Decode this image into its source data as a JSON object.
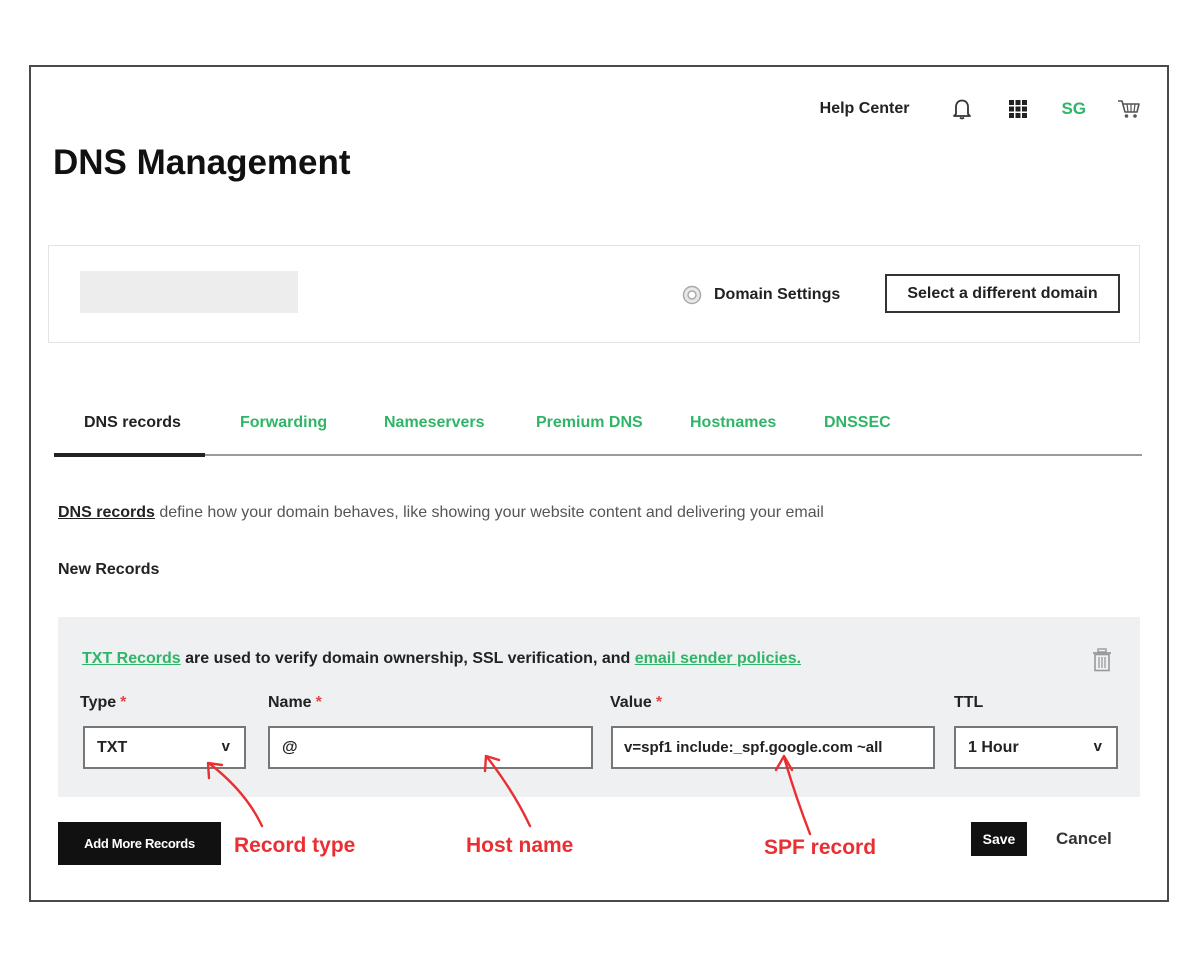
{
  "header": {
    "help_center": "Help Center",
    "user_initials": "SG",
    "icons": [
      "bell-icon",
      "apps-grid-icon",
      "cart-icon"
    ]
  },
  "page_title": "DNS Management",
  "domain_card": {
    "domain_settings": "Domain Settings",
    "select_domain_button": "Select a different domain"
  },
  "tabs": [
    {
      "label": "DNS records",
      "active": true
    },
    {
      "label": "Forwarding",
      "active": false
    },
    {
      "label": "Nameservers",
      "active": false
    },
    {
      "label": "Premium DNS",
      "active": false
    },
    {
      "label": "Hostnames",
      "active": false
    },
    {
      "label": "DNSSEC",
      "active": false
    }
  ],
  "description": {
    "link": "DNS records",
    "text": " define how your domain behaves, like showing your website content and delivering your email"
  },
  "new_records_heading": "New Records",
  "record_form": {
    "info_link_1": "TXT Records",
    "info_text": " are used to verify domain ownership, SSL verification, and ",
    "info_link_2": "email sender policies.",
    "required_marker": "*",
    "dropdown_marker": "v",
    "type": {
      "label": "Type",
      "value": "TXT"
    },
    "name": {
      "label": "Name",
      "value": "@"
    },
    "value": {
      "label": "Value",
      "value": "v=spf1 include:_spf.google.com ~all"
    },
    "ttl": {
      "label": "TTL",
      "value": "1 Hour"
    }
  },
  "actions": {
    "add_more": "Add More Records",
    "save": "Save",
    "cancel": "Cancel"
  },
  "annotations": {
    "record_type": "Record type",
    "host_name": "Host name",
    "spf_record": "SPF record"
  },
  "colors": {
    "accent_green": "#2fb567",
    "required_red": "#e0474c",
    "annotation_red": "#ea2f33",
    "panel_bg": "#eff0f1"
  }
}
